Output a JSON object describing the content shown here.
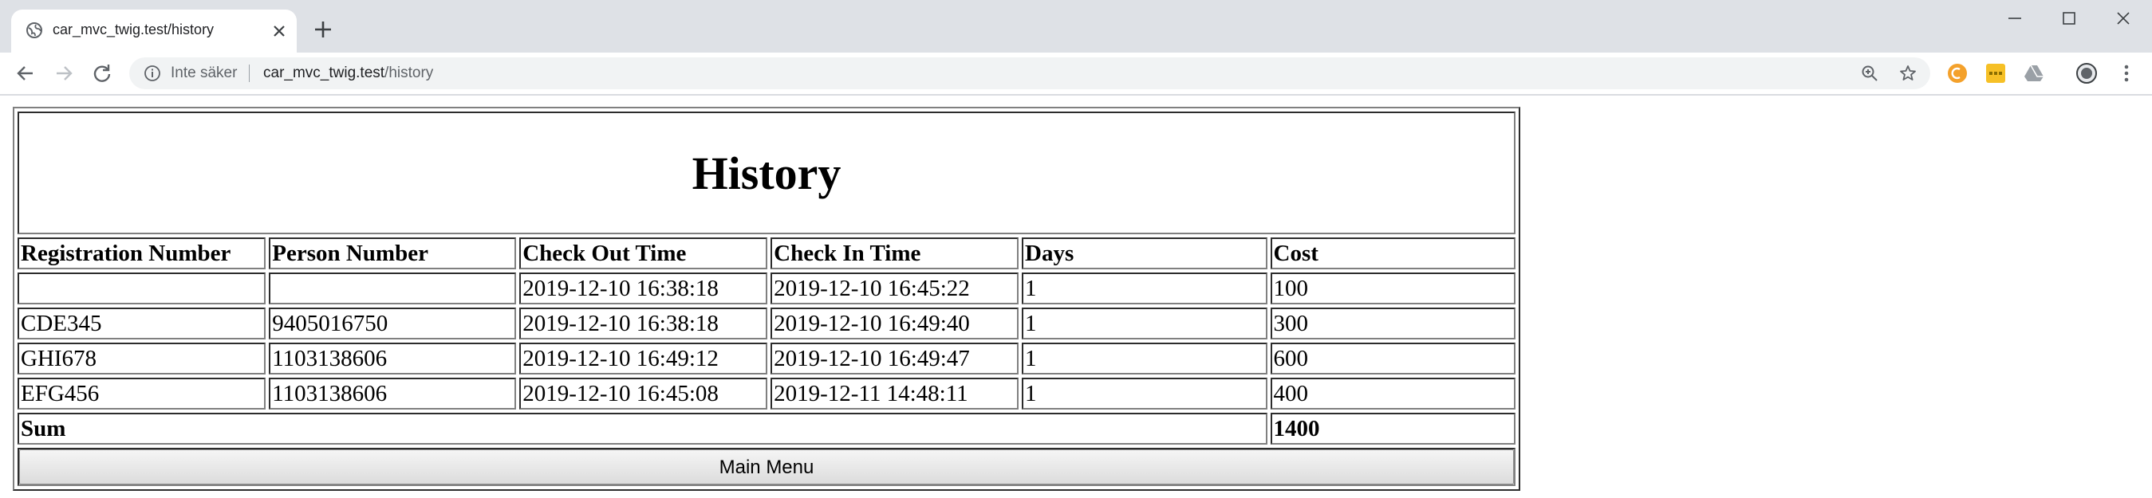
{
  "browser": {
    "tab": {
      "title": "car_mvc_twig.test/history",
      "favicon": "globe-icon"
    },
    "window_controls": [
      "minimize-icon",
      "maximize-icon",
      "close-icon"
    ],
    "nav": [
      "back-arrow-icon",
      "forward-arrow-icon",
      "reload-icon"
    ],
    "omnibox": {
      "security_label": "Inte säker",
      "url_host": "car_mvc_twig.test",
      "url_path": "/history"
    },
    "omnibox_icons": [
      "zoom-icon",
      "bookmark-star-icon"
    ],
    "extensions": [
      "orange-extension-icon",
      "yellow-extension-icon",
      "drive-extension-icon",
      "profile-avatar-icon",
      "more-menu-icon"
    ]
  },
  "page": {
    "title": "History",
    "columns": [
      "Registration Number",
      "Person Number",
      "Check Out Time",
      "Check In Time",
      "Days",
      "Cost"
    ],
    "rows": [
      [
        "",
        "",
        "2019-12-10 16:38:18",
        "2019-12-10 16:45:22",
        "1",
        "100"
      ],
      [
        "CDE345",
        "9405016750",
        "2019-12-10 16:38:18",
        "2019-12-10 16:49:40",
        "1",
        "300"
      ],
      [
        "GHI678",
        "1103138606",
        "2019-12-10 16:49:12",
        "2019-12-10 16:49:47",
        "1",
        "600"
      ],
      [
        "EFG456",
        "1103138606",
        "2019-12-10 16:45:08",
        "2019-12-11 14:48:11",
        "1",
        "400"
      ]
    ],
    "sum_label": "Sum",
    "sum_value": "1400",
    "main_menu_label": "Main Menu"
  },
  "colors": {
    "tabstrip": "#dee1e6",
    "omnibox": "#f1f3f4",
    "table_border": "#808080"
  }
}
